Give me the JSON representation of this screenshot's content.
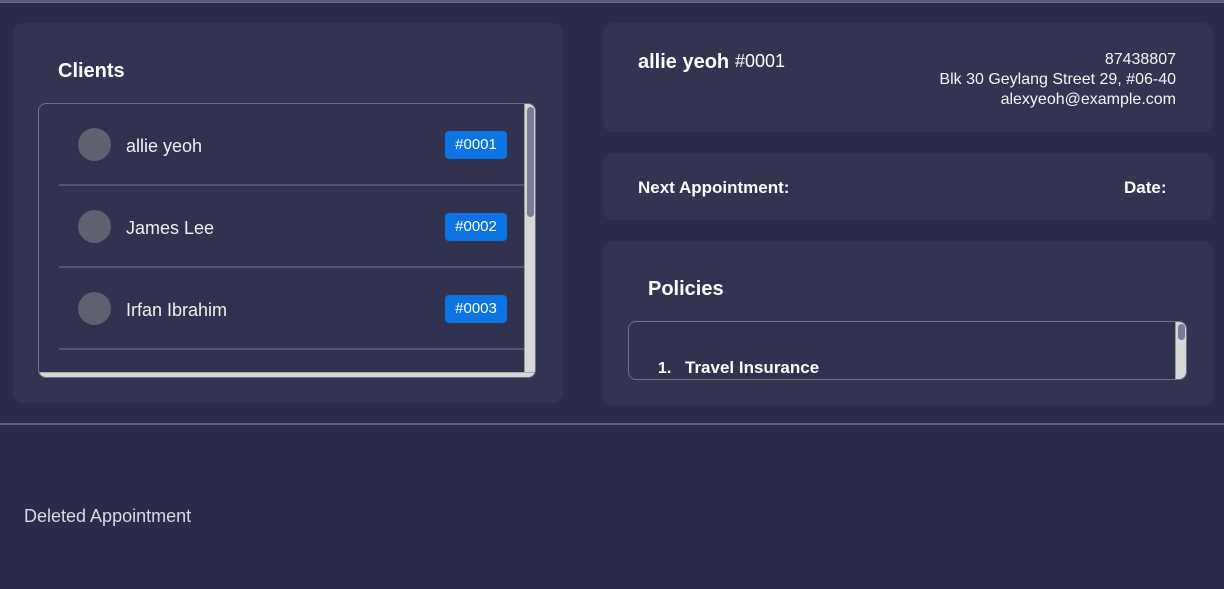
{
  "clients": {
    "title": "Clients",
    "items": [
      {
        "name": "allie yeoh",
        "id": "#0001"
      },
      {
        "name": "James Lee",
        "id": "#0002"
      },
      {
        "name": "Irfan Ibrahim",
        "id": "#0003"
      }
    ]
  },
  "detail": {
    "name": "allie yeoh",
    "id": "#0001",
    "phone": "87438807",
    "address": "Blk 30 Geylang Street 29, #06-40",
    "email": "alexyeoh@example.com"
  },
  "appointment": {
    "next_label": "Next Appointment:",
    "date_label": "Date:"
  },
  "policies": {
    "title": "Policies",
    "items": [
      {
        "number": "1.",
        "name": "Travel Insurance"
      }
    ]
  },
  "result": {
    "message": "Deleted Appointment"
  },
  "colors": {
    "background": "#2b2b4a",
    "card": "#333452",
    "badge": "#0d74e3"
  }
}
